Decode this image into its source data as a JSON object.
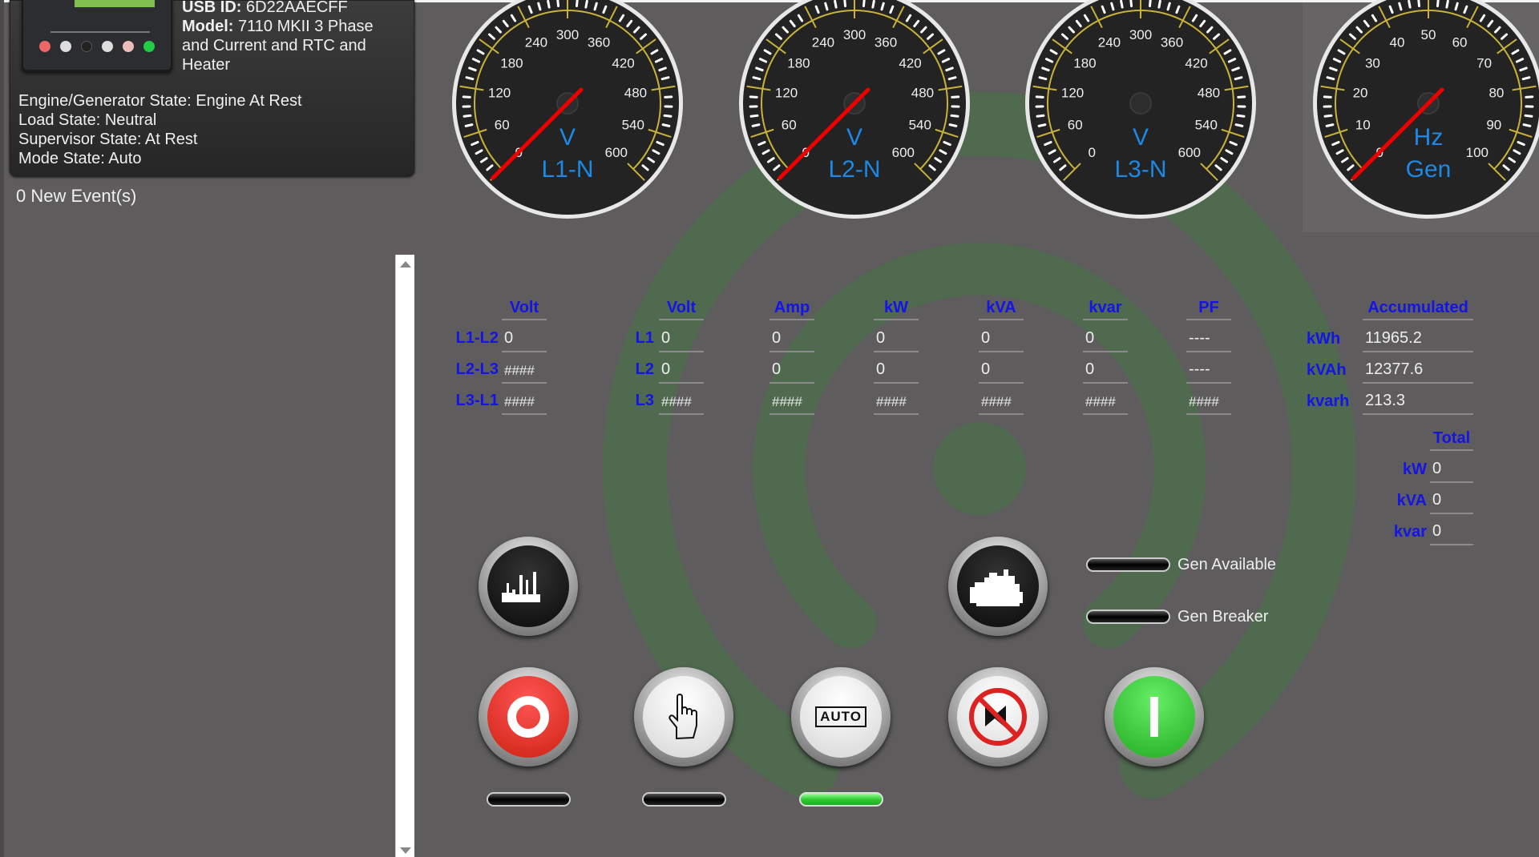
{
  "device": {
    "usb_id_label": "USB ID:",
    "usb_id": "6D22AAECFF",
    "model_label": "Model:",
    "model": "7110 MKII 3 Phase",
    "model_line2": "and Current and RTC and",
    "model_line3": "Heater",
    "engine_state": "Engine/Generator State: Engine At Rest",
    "load_state": "Load State: Neutral",
    "supervisor_state": "Supervisor State: At Rest",
    "mode_state": "Mode State: Auto"
  },
  "events": "0 New Event(s)",
  "gauges": [
    {
      "unit": "V",
      "label": "L1-N",
      "min": 0,
      "max": 600,
      "step": 60,
      "value": 0,
      "needle_visible": true
    },
    {
      "unit": "V",
      "label": "L2-N",
      "min": 0,
      "max": 600,
      "step": 60,
      "value": 0,
      "needle_visible": true
    },
    {
      "unit": "V",
      "label": "L3-N",
      "min": 0,
      "max": 600,
      "step": 60,
      "value": 0,
      "needle_visible": false
    },
    {
      "unit": "Hz",
      "label": "Gen",
      "min": 0,
      "max": 100,
      "step": 10,
      "value": 0,
      "needle_visible": true
    }
  ],
  "line_voltage": {
    "header": "Volt",
    "rows": [
      {
        "label": "L1-L2",
        "value": "0"
      },
      {
        "label": "L2-L3",
        "value": "####"
      },
      {
        "label": "L3-L1",
        "value": "####"
      }
    ]
  },
  "phase": {
    "headers": [
      "Volt",
      "Amp",
      "kW",
      "kVA",
      "kvar",
      "PF"
    ],
    "rows": [
      {
        "label": "L1",
        "values": [
          "0",
          "0",
          "0",
          "0",
          "0",
          "----"
        ]
      },
      {
        "label": "L2",
        "values": [
          "0",
          "0",
          "0",
          "0",
          "0",
          "----"
        ]
      },
      {
        "label": "L3",
        "values": [
          "####",
          "####",
          "####",
          "####",
          "####",
          "####"
        ]
      }
    ]
  },
  "accumulated": {
    "header": "Accumulated",
    "rows": [
      {
        "label": "kWh",
        "value": "11965.2"
      },
      {
        "label": "kVAh",
        "value": "12377.6"
      },
      {
        "label": "kvarh",
        "value": "213.3"
      }
    ]
  },
  "total": {
    "header": "Total",
    "rows": [
      {
        "label": "kW",
        "value": "0"
      },
      {
        "label": "kVA",
        "value": "0"
      },
      {
        "label": "kvar",
        "value": "0"
      }
    ]
  },
  "indicators": {
    "gen_available": "Gen Available",
    "gen_breaker": "Gen Breaker"
  },
  "buttons": {
    "auto_text": "AUTO"
  },
  "colors": {
    "accent_blue": "#1414e6",
    "gauge_label": "#1e88e5",
    "watermark": "#4f6a4f"
  }
}
